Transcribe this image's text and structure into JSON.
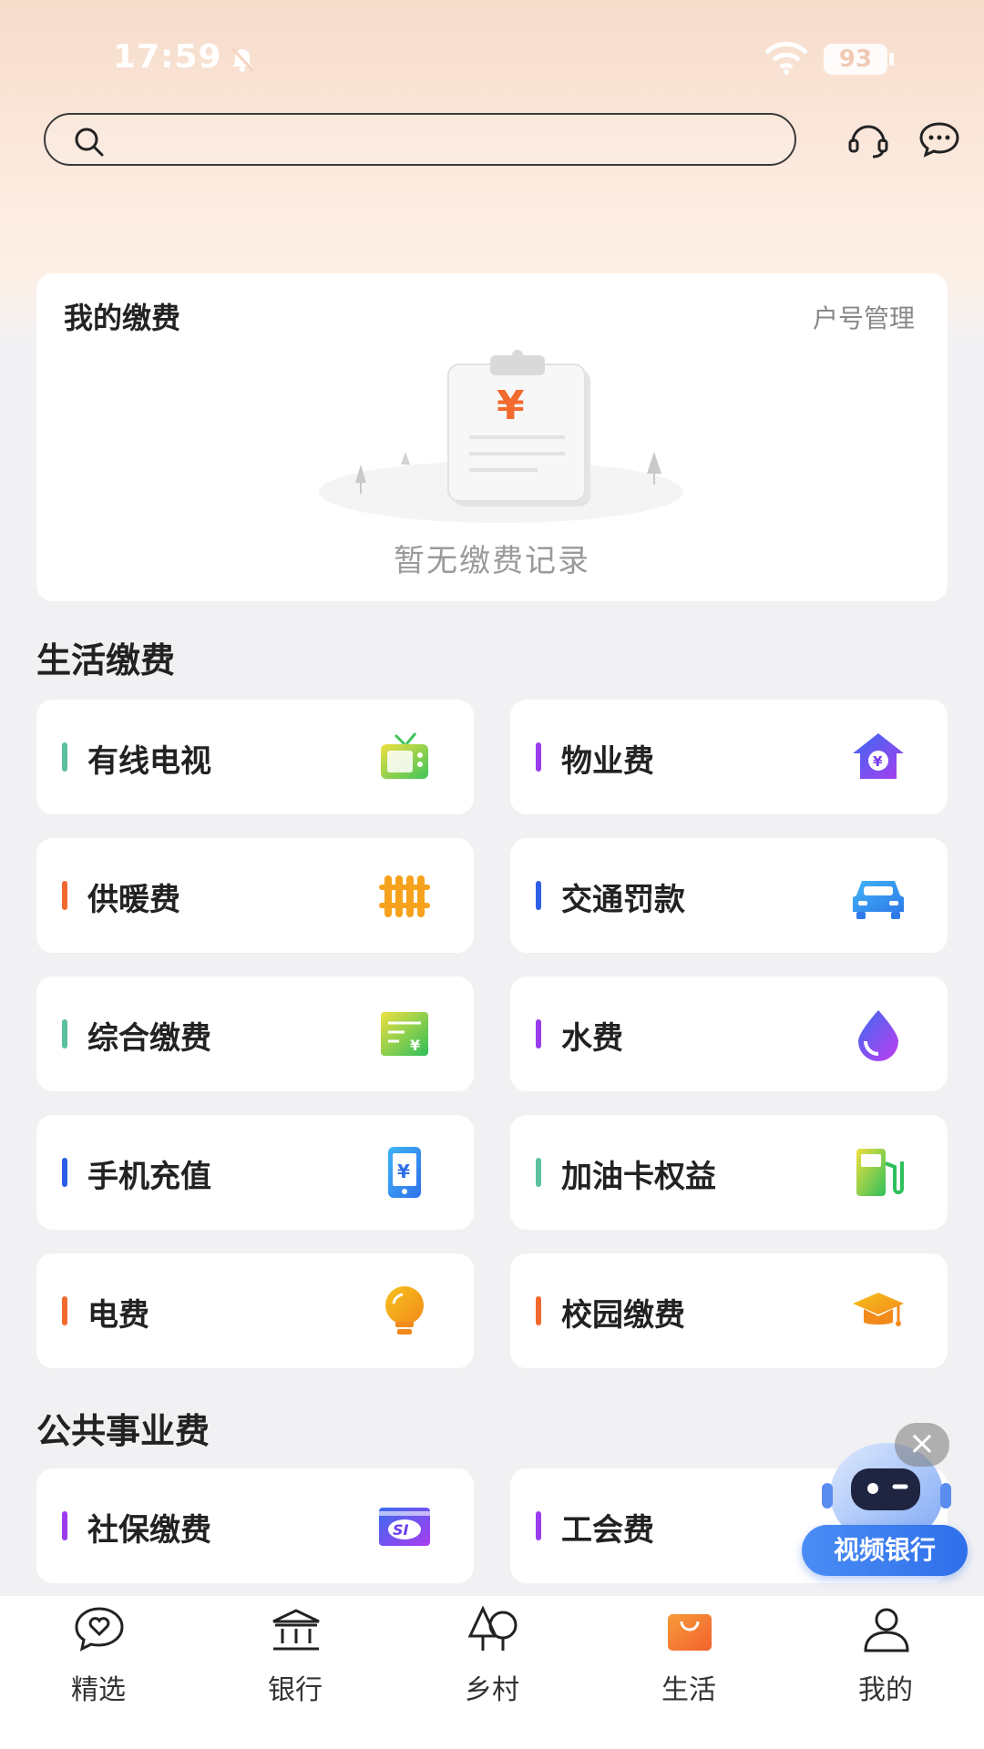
{
  "status_bar": {
    "time": "17:59",
    "battery": "93"
  },
  "search": {
    "placeholder": ""
  },
  "my_fees": {
    "title": "我的缴费",
    "manage_link": "户号管理",
    "empty_text": "暂无缴费记录"
  },
  "life_section": {
    "title": "生活缴费",
    "items": [
      {
        "label": "有线电视",
        "bar_color": "#5bc0a0",
        "icon": "tv-icon"
      },
      {
        "label": "物业费",
        "bar_color": "#9b3cf0",
        "icon": "house-yuan-icon"
      },
      {
        "label": "供暖费",
        "bar_color": "#f26a2e",
        "icon": "radiator-icon"
      },
      {
        "label": "交通罚款",
        "bar_color": "#2f5fe6",
        "icon": "car-icon"
      },
      {
        "label": "综合缴费",
        "bar_color": "#5bc0a0",
        "icon": "bill-icon"
      },
      {
        "label": "水费",
        "bar_color": "#9b3cf0",
        "icon": "water-drop-icon"
      },
      {
        "label": "手机充值",
        "bar_color": "#2f5fe6",
        "icon": "phone-yuan-icon"
      },
      {
        "label": "加油卡权益",
        "bar_color": "#5bc0a0",
        "icon": "gas-pump-icon"
      },
      {
        "label": "电费",
        "bar_color": "#f26a2e",
        "icon": "bulb-icon"
      },
      {
        "label": "校园缴费",
        "bar_color": "#f26a2e",
        "icon": "graduation-cap-icon"
      }
    ]
  },
  "public_section": {
    "title": "公共事业费",
    "items": [
      {
        "label": "社保缴费",
        "bar_color": "#9b3cf0",
        "icon": "social-security-icon"
      },
      {
        "label": "工会费",
        "bar_color": "#9b3cf0",
        "icon": ""
      }
    ]
  },
  "float_robot": {
    "label": "视频银行",
    "close": "×"
  },
  "nav": {
    "items": [
      {
        "label": "精选",
        "icon": "heart-chat-icon"
      },
      {
        "label": "银行",
        "icon": "bank-icon"
      },
      {
        "label": "乡村",
        "icon": "tree-icon"
      },
      {
        "label": "生活",
        "icon": "shopping-bag-icon"
      },
      {
        "label": "我的",
        "icon": "person-icon"
      }
    ],
    "active_color": "#f2702e"
  }
}
